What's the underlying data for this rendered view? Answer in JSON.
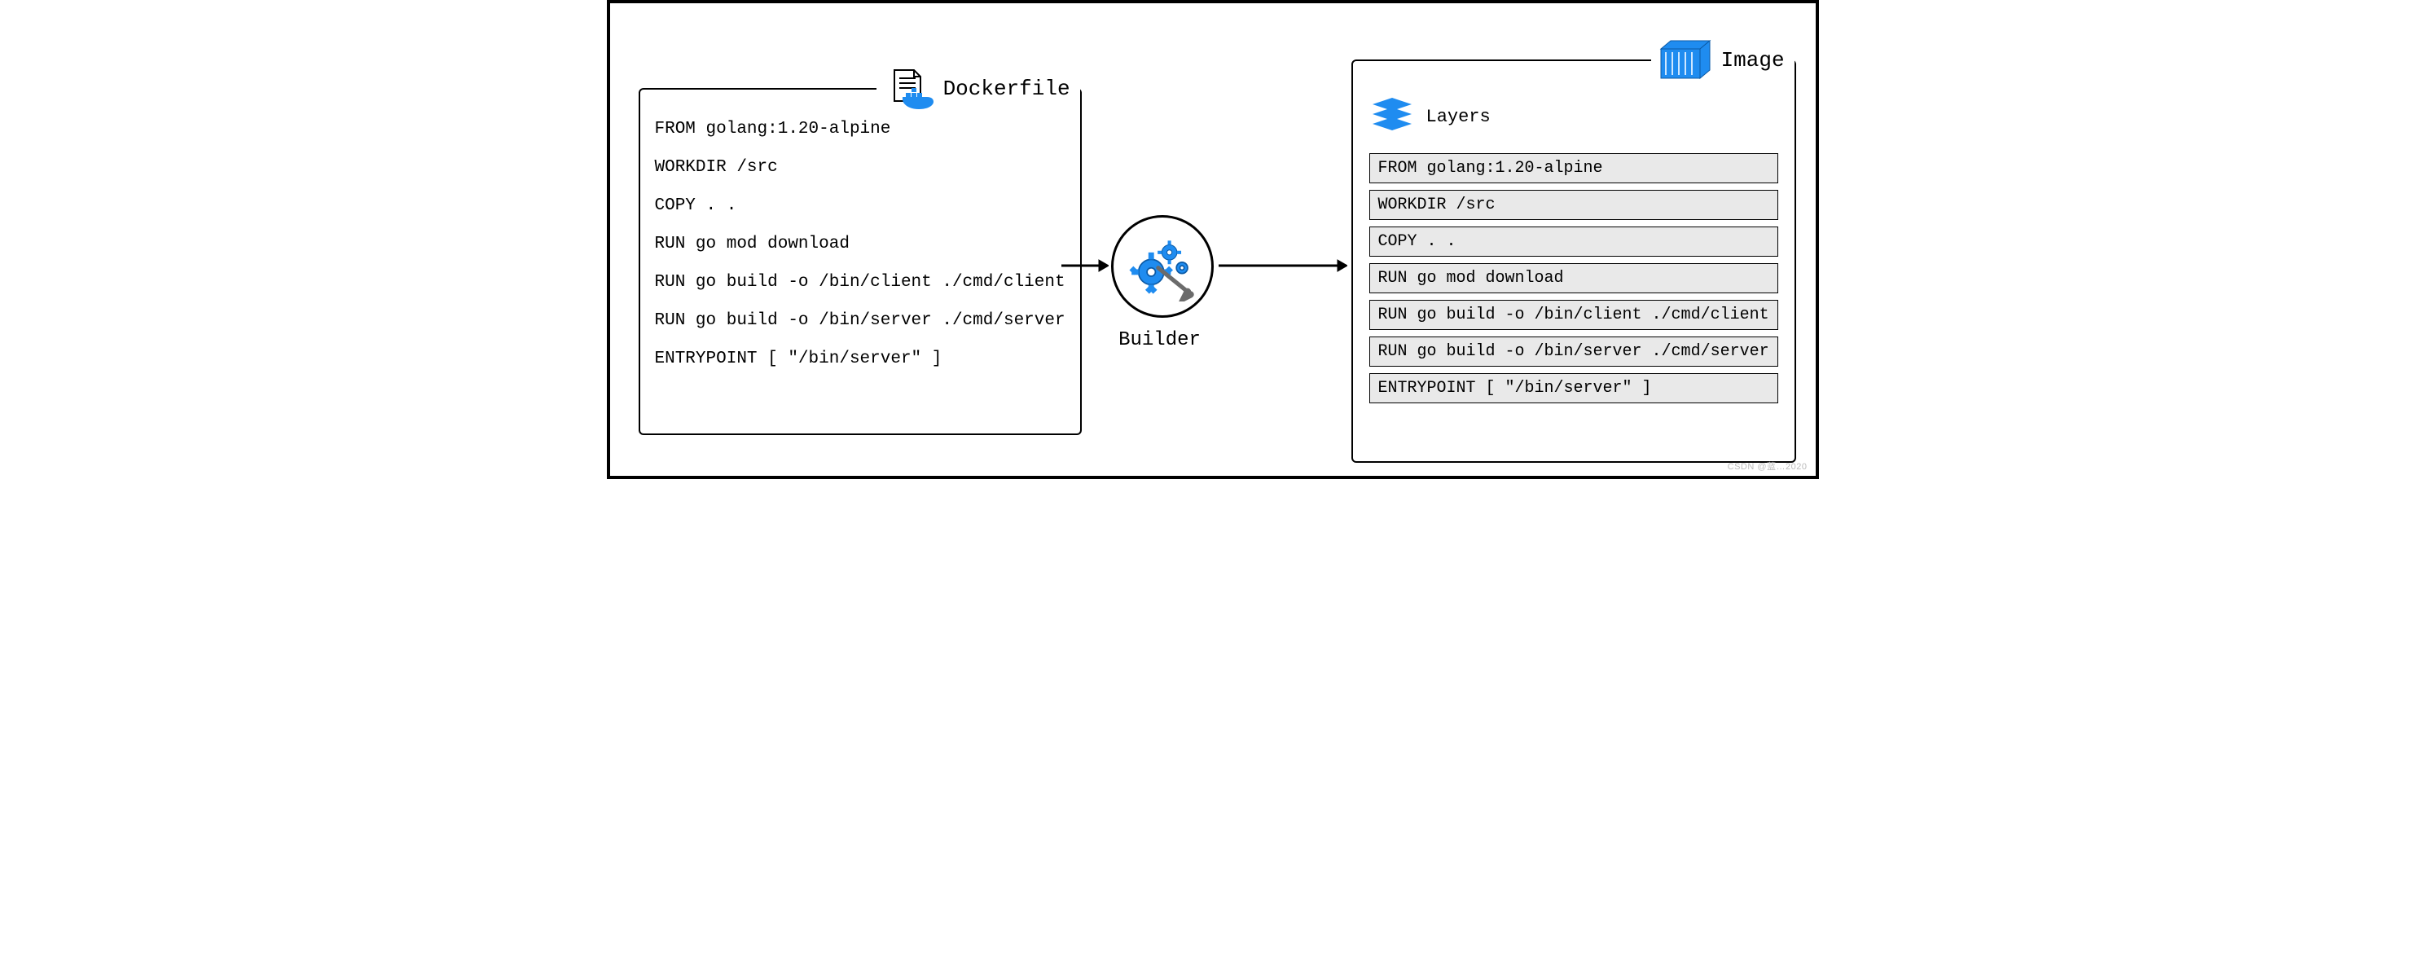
{
  "dockerfile": {
    "title": "Dockerfile",
    "lines": [
      "FROM golang:1.20-alpine",
      "WORKDIR /src",
      "COPY . .",
      "RUN go mod download",
      "RUN go build -o /bin/client ./cmd/client",
      "RUN go build -o /bin/server ./cmd/server",
      "ENTRYPOINT [ \"/bin/server\" ]"
    ]
  },
  "builder": {
    "label": "Builder"
  },
  "image": {
    "title": "Image",
    "subheader": "Layers",
    "layers": [
      "FROM golang:1.20-alpine",
      "WORKDIR /src",
      "COPY . .",
      "RUN go mod download",
      "RUN go build -o /bin/client ./cmd/client",
      "RUN go build -o /bin/server ./cmd/server",
      "ENTRYPOINT [ \"/bin/server\" ]"
    ]
  },
  "colors": {
    "accent_blue": "#1f8cf0",
    "layer_bg": "#e9e9e9"
  },
  "watermark": "CSDN @蓝…2020"
}
